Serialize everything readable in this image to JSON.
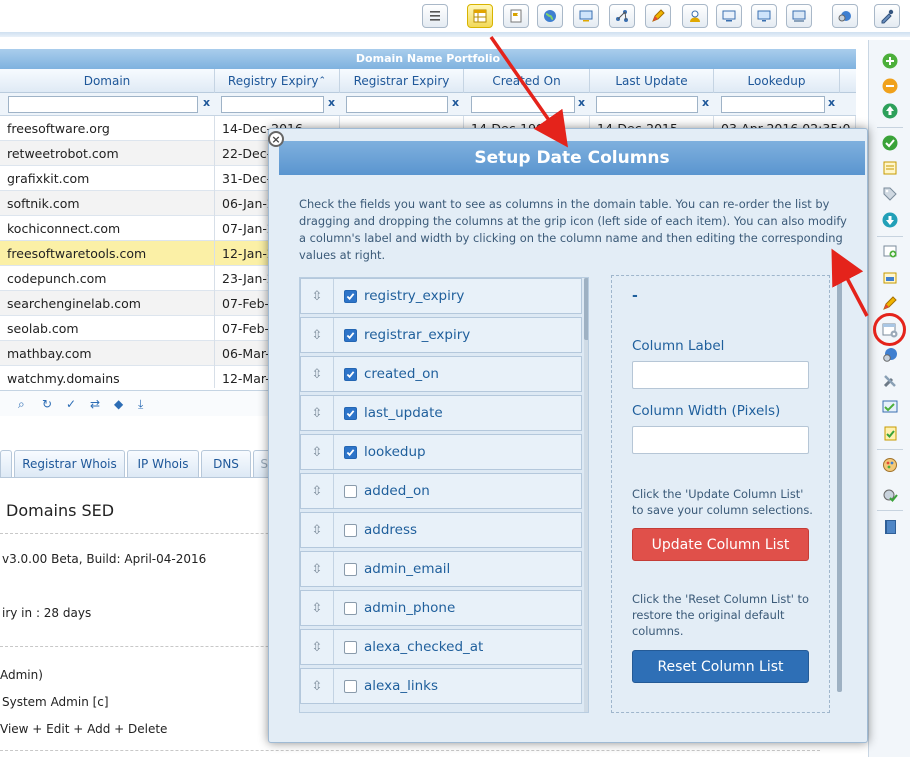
{
  "grid": {
    "title": "Domain Name Portfolio",
    "columns": [
      "Domain",
      "Registry Expiry",
      "Registrar Expiry",
      "Created On",
      "Last Update",
      "Lookedup"
    ],
    "sort_indicator": "⌃",
    "filter_clear": "x",
    "rows": [
      {
        "domain": "freesoftware.org",
        "registry_expiry": "14-Dec-2016",
        "registrar_expiry": "",
        "created_on": "14-Dec-1999",
        "last_update": "14-Dec-2015",
        "lookedup": "03-Apr-2016 02:35:0"
      },
      {
        "domain": "retweetrobot.com",
        "registry_expiry": "22-Dec-20",
        "registrar_expiry": "",
        "created_on": "",
        "last_update": "",
        "lookedup": ""
      },
      {
        "domain": "grafixkit.com",
        "registry_expiry": "31-Dec-20",
        "registrar_expiry": "",
        "created_on": "",
        "last_update": "",
        "lookedup": ""
      },
      {
        "domain": "softnik.com",
        "registry_expiry": "06-Jan-201",
        "registrar_expiry": "",
        "created_on": "",
        "last_update": "",
        "lookedup": ""
      },
      {
        "domain": "kochiconnect.com",
        "registry_expiry": "07-Jan-201",
        "registrar_expiry": "",
        "created_on": "",
        "last_update": "",
        "lookedup": ""
      },
      {
        "domain": "freesoftwaretools.com",
        "registry_expiry": "12-Jan-201",
        "registrar_expiry": "",
        "created_on": "",
        "last_update": "",
        "lookedup": ""
      },
      {
        "domain": "codepunch.com",
        "registry_expiry": "23-Jan-201",
        "registrar_expiry": "",
        "created_on": "",
        "last_update": "",
        "lookedup": ""
      },
      {
        "domain": "searchenginelab.com",
        "registry_expiry": "07-Feb-20",
        "registrar_expiry": "",
        "created_on": "",
        "last_update": "",
        "lookedup": ""
      },
      {
        "domain": "seolab.com",
        "registry_expiry": "07-Feb-20",
        "registrar_expiry": "",
        "created_on": "",
        "last_update": "",
        "lookedup": ""
      },
      {
        "domain": "mathbay.com",
        "registry_expiry": "06-Mar-20",
        "registrar_expiry": "",
        "created_on": "",
        "last_update": "",
        "lookedup": ""
      },
      {
        "domain": "watchmy.domains",
        "registry_expiry": "12-Mar-20",
        "registrar_expiry": "",
        "created_on": "",
        "last_update": "",
        "lookedup": ""
      }
    ],
    "footer_icons": [
      "search-icon",
      "refresh-icon",
      "check-icon",
      "swap-icon",
      "tag-icon",
      "download-icon"
    ]
  },
  "lower": {
    "tabs": [
      "Registrar Whois",
      "IP Whois",
      "DNS",
      "SS"
    ],
    "title": "Domains SED",
    "version": "v3.0.00 Beta, Build: April-04-2016",
    "expiry": "iry in : 28 days",
    "role": "Admin)",
    "user": "System Admin [c]",
    "perms": "View + Edit + Add + Delete"
  },
  "modal": {
    "title": "Setup Date Columns",
    "close_glyph": "×",
    "description": "Check the fields you want to see as columns in the domain table. You can re-order the list by dragging and dropping the columns at the grip icon (left side of each item). You can also modify a column's label and width by clicking on the column name and then editing the corresponding values at right.",
    "fields": [
      {
        "name": "registry_expiry",
        "checked": true
      },
      {
        "name": "registrar_expiry",
        "checked": true
      },
      {
        "name": "created_on",
        "checked": true
      },
      {
        "name": "last_update",
        "checked": true
      },
      {
        "name": "lookedup",
        "checked": true
      },
      {
        "name": "added_on",
        "checked": false
      },
      {
        "name": "address",
        "checked": false
      },
      {
        "name": "admin_email",
        "checked": false
      },
      {
        "name": "admin_phone",
        "checked": false
      },
      {
        "name": "alexa_checked_at",
        "checked": false
      },
      {
        "name": "alexa_links",
        "checked": false
      }
    ],
    "editor": {
      "selected": "-",
      "label_caption": "Column Label",
      "width_caption": "Column Width (Pixels)",
      "update_hint": "Click the 'Update Column List' to save your column selections.",
      "update_button": "Update Column List",
      "reset_hint": "Click the 'Reset Column List' to restore the original default columns.",
      "reset_button": "Reset Column List"
    }
  },
  "colors": {
    "accent": "#5a95cf",
    "highlight_row": "#fbf0a6",
    "update_button": "#e0504a",
    "reset_button": "#2e6fb6",
    "annotation": "#e4231b"
  }
}
